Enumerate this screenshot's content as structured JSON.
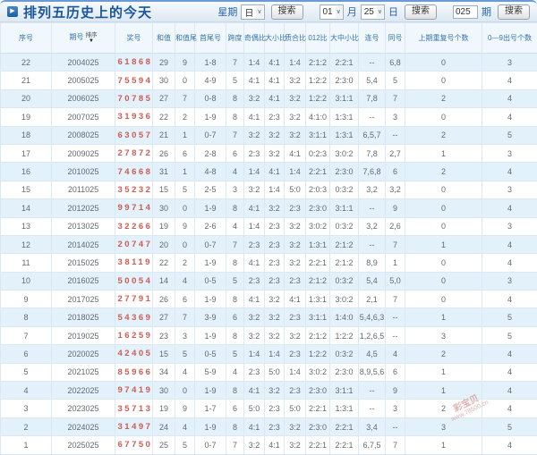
{
  "title": "排列五历史上的今天",
  "search": {
    "weekday_label": "星期",
    "weekday_value": "日",
    "search_button": "搜索",
    "month_value": "01",
    "month_label": "月",
    "day_value": "25",
    "day_label": "日",
    "period_value": "025",
    "period_label": "期"
  },
  "table": {
    "sort_label": "排序",
    "columns": [
      "序号",
      "期号",
      "奖号",
      "和值",
      "和值尾",
      "首尾号",
      "跨度",
      "奇偶比",
      "大小比",
      "质合比",
      "012比",
      "大中小比",
      "连号",
      "同号",
      "上期重复号个数",
      "0—9出号个数"
    ],
    "column_keys": [
      "xuhao",
      "qihao",
      "jianghao",
      "hezhi",
      "hezhiwei",
      "shouweihao",
      "kuadu",
      "jioubi",
      "daxiaobi",
      "zhihebi",
      "bi012",
      "dazhongxiaobi",
      "lianhao",
      "tonghao",
      "shangqi-chongfu",
      "chuhao-geshu"
    ],
    "rows": [
      [
        "22",
        "2004025",
        "61868",
        "29",
        "9",
        "1-8",
        "7",
        "1:4",
        "4:1",
        "1:4",
        "2:1:2",
        "2:2:1",
        "--",
        "6,8",
        "0",
        "3"
      ],
      [
        "21",
        "2005025",
        "75594",
        "30",
        "0",
        "4-9",
        "5",
        "4:1",
        "4:1",
        "3:2",
        "1:2:2",
        "2:3:0",
        "5,4",
        "5",
        "0",
        "4"
      ],
      [
        "20",
        "2006025",
        "70785",
        "27",
        "7",
        "0-8",
        "8",
        "3:2",
        "4:1",
        "3:2",
        "1:2:2",
        "3:1:1",
        "7,8",
        "7",
        "2",
        "4"
      ],
      [
        "19",
        "2007025",
        "31936",
        "22",
        "2",
        "1-9",
        "8",
        "4:1",
        "2:3",
        "3:2",
        "4:1:0",
        "1:3:1",
        "--",
        "3",
        "0",
        "4"
      ],
      [
        "18",
        "2008025",
        "63057",
        "21",
        "1",
        "0-7",
        "7",
        "3:2",
        "3:2",
        "3:2",
        "3:1:1",
        "1:3:1",
        "6,5,7",
        "--",
        "2",
        "5"
      ],
      [
        "17",
        "2009025",
        "27872",
        "26",
        "6",
        "2-8",
        "6",
        "2:3",
        "3:2",
        "4:1",
        "0:2:3",
        "3:0:2",
        "7,8",
        "2,7",
        "1",
        "3"
      ],
      [
        "16",
        "2010025",
        "74668",
        "31",
        "1",
        "4-8",
        "4",
        "1:4",
        "4:1",
        "1:4",
        "2:2:1",
        "2:3:0",
        "7,6,8",
        "6",
        "2",
        "4"
      ],
      [
        "15",
        "2011025",
        "35232",
        "15",
        "5",
        "2-5",
        "3",
        "3:2",
        "1:4",
        "5:0",
        "2:0:3",
        "0:3:2",
        "3,2",
        "3,2",
        "0",
        "3"
      ],
      [
        "14",
        "2012025",
        "99714",
        "30",
        "0",
        "1-9",
        "8",
        "4:1",
        "3:2",
        "2:3",
        "2:3:0",
        "3:1:1",
        "--",
        "9",
        "0",
        "4"
      ],
      [
        "13",
        "2013025",
        "32266",
        "19",
        "9",
        "2-6",
        "4",
        "1:4",
        "2:3",
        "3:2",
        "3:0:2",
        "0:3:2",
        "3,2",
        "2,6",
        "0",
        "3"
      ],
      [
        "12",
        "2014025",
        "20747",
        "20",
        "0",
        "0-7",
        "7",
        "2:3",
        "2:3",
        "3:2",
        "1:3:1",
        "2:1:2",
        "--",
        "7",
        "1",
        "4"
      ],
      [
        "11",
        "2015025",
        "38119",
        "22",
        "2",
        "1-9",
        "8",
        "4:1",
        "2:3",
        "3:2",
        "2:2:1",
        "2:1:2",
        "8,9",
        "1",
        "0",
        "4"
      ],
      [
        "10",
        "2016025",
        "50054",
        "14",
        "4",
        "0-5",
        "5",
        "2:3",
        "2:3",
        "2:3",
        "2:1:2",
        "0:3:2",
        "5,4",
        "5,0",
        "0",
        "3"
      ],
      [
        "9",
        "2017025",
        "27791",
        "26",
        "6",
        "1-9",
        "8",
        "4:1",
        "3:2",
        "4:1",
        "1:3:1",
        "3:0:2",
        "2,1",
        "7",
        "0",
        "4"
      ],
      [
        "8",
        "2018025",
        "54369",
        "27",
        "7",
        "3-9",
        "6",
        "3:2",
        "3:2",
        "2:3",
        "3:1:1",
        "1:4:0",
        "5,4,6,3",
        "--",
        "1",
        "5"
      ],
      [
        "7",
        "2019025",
        "16259",
        "23",
        "3",
        "1-9",
        "8",
        "3:2",
        "3:2",
        "3:2",
        "2:1:2",
        "1:2:2",
        "1,2,6,5",
        "--",
        "3",
        "5"
      ],
      [
        "6",
        "2020025",
        "42405",
        "15",
        "5",
        "0-5",
        "5",
        "1:4",
        "1:4",
        "2:3",
        "1:2:2",
        "0:3:2",
        "4,5",
        "4",
        "2",
        "4"
      ],
      [
        "5",
        "2021025",
        "85966",
        "34",
        "4",
        "5-9",
        "4",
        "2:3",
        "5:0",
        "1:4",
        "3:0:2",
        "2:3:0",
        "8,9,5,6",
        "6",
        "1",
        "4"
      ],
      [
        "4",
        "2022025",
        "97419",
        "30",
        "0",
        "1-9",
        "8",
        "4:1",
        "3:2",
        "2:3",
        "2:3:0",
        "3:1:1",
        "--",
        "9",
        "1",
        "4"
      ],
      [
        "3",
        "2023025",
        "35713",
        "19",
        "9",
        "1-7",
        "6",
        "5:0",
        "2:3",
        "5:0",
        "2:2:1",
        "1:3:1",
        "--",
        "3",
        "2",
        "4"
      ],
      [
        "2",
        "2024025",
        "31497",
        "24",
        "4",
        "1-9",
        "8",
        "4:1",
        "2:3",
        "3:2",
        "2:3:0",
        "2:2:1",
        "3,4",
        "--",
        "3",
        "5"
      ],
      [
        "1",
        "2025025",
        "67750",
        "25",
        "5",
        "0-7",
        "7",
        "3:2",
        "4:1",
        "3:2",
        "2:2:1",
        "2:2:1",
        "6,7,5",
        "7",
        "1",
        "4"
      ]
    ]
  },
  "watermark": {
    "line1": "彩宝贝",
    "line2": "www.78500.cn"
  },
  "colors": {
    "accent_blue": "#19569b",
    "header_text": "#3673ad",
    "row_alt": "#e3f1fb",
    "prize_red": "#cb5d55"
  }
}
